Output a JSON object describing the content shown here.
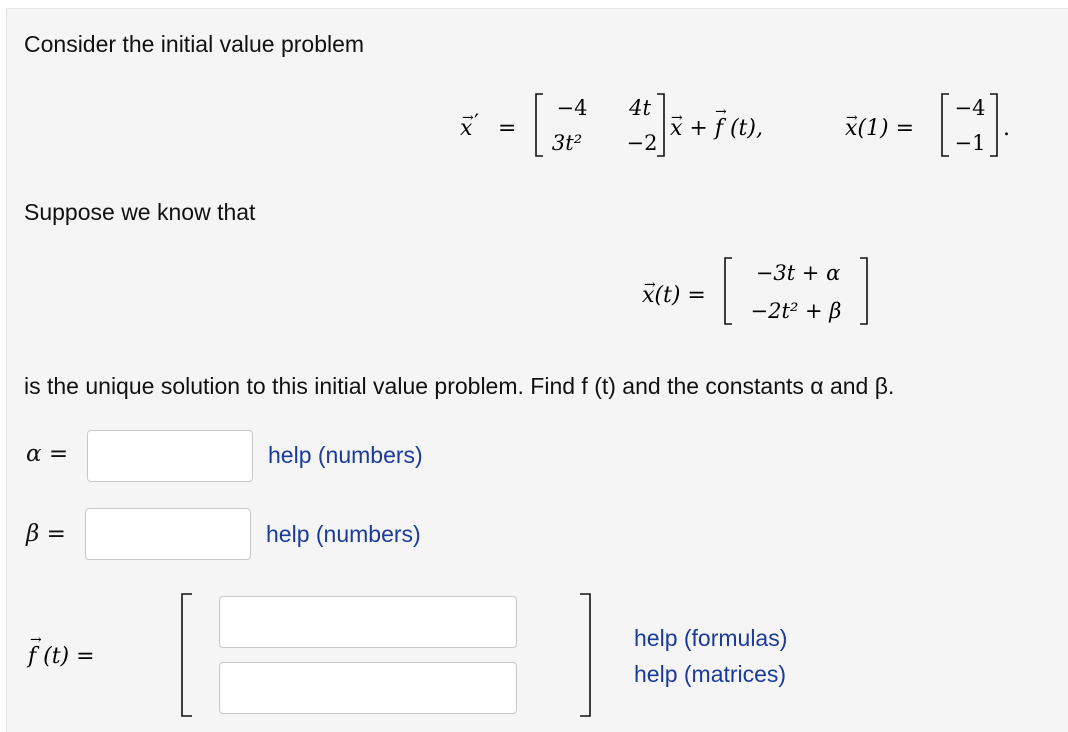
{
  "problem": {
    "intro": "Consider the initial value problem",
    "ode": {
      "lhs": "x",
      "prime": "′",
      "eq": "=",
      "matrix": [
        [
          "−4",
          "4t"
        ],
        [
          "3t²",
          "−2"
        ]
      ],
      "plus_term": "x + f (t),",
      "ic_lhs": "x(1) =",
      "ic_vector": [
        "−4",
        "−1"
      ],
      "ic_end": "."
    },
    "suppose": "Suppose we know that",
    "solution": {
      "lhs": "x(t) =",
      "vector": [
        "−3t + α",
        "−2t² + β"
      ]
    },
    "task": "is the unique solution to this initial value problem. Find f (t) and the constants α and β.",
    "alpha": {
      "label": "α =",
      "value": "",
      "help": "help (numbers)"
    },
    "beta": {
      "label": "β =",
      "value": "",
      "help": "help (numbers)"
    },
    "f": {
      "label": "f (t) =",
      "entries": [
        "",
        ""
      ],
      "help_formulas": "help (formulas)",
      "help_matrices": "help (matrices)"
    }
  }
}
